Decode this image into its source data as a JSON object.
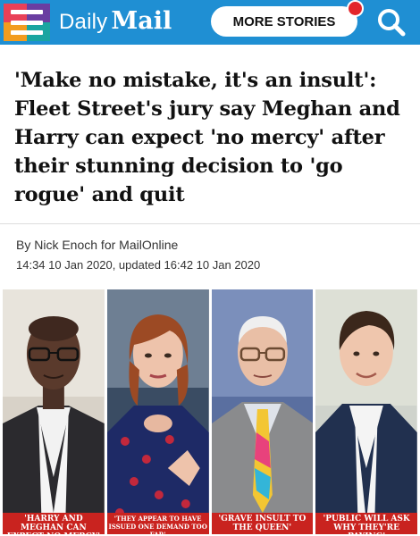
{
  "header": {
    "logo_daily": "Daily",
    "logo_mail": "Mail",
    "more_stories_label": "MORE STORIES",
    "icons": [
      "menu-icon",
      "search-icon",
      "notification-dot"
    ],
    "colors": {
      "bar": "#1f8fd3",
      "notify": "#e3262b"
    }
  },
  "article": {
    "headline": "'Make no mistake, it's an insult': Fleet Street's jury say Meghan and Harry can expect 'no mercy' after their stunning decision to 'go rogue' and quit",
    "byline_prefix": "By ",
    "author": "Nick Enoch for MailOnline",
    "dateline": "14:34 10 Jan 2020, updated 16:42 10 Jan 2020"
  },
  "photos": [
    {
      "caption": "'HARRY AND MEGHAN CAN EXPECT NO MERCY'"
    },
    {
      "caption": "'THEY APPEAR TO HAVE ISSUED ONE DEMAND TOO FAR'"
    },
    {
      "caption": "'GRAVE INSULT TO THE QUEEN'"
    },
    {
      "caption": "'PUBLIC WILL ASK WHY THEY'RE PAYING'"
    }
  ],
  "caption_color": "#c9231f"
}
